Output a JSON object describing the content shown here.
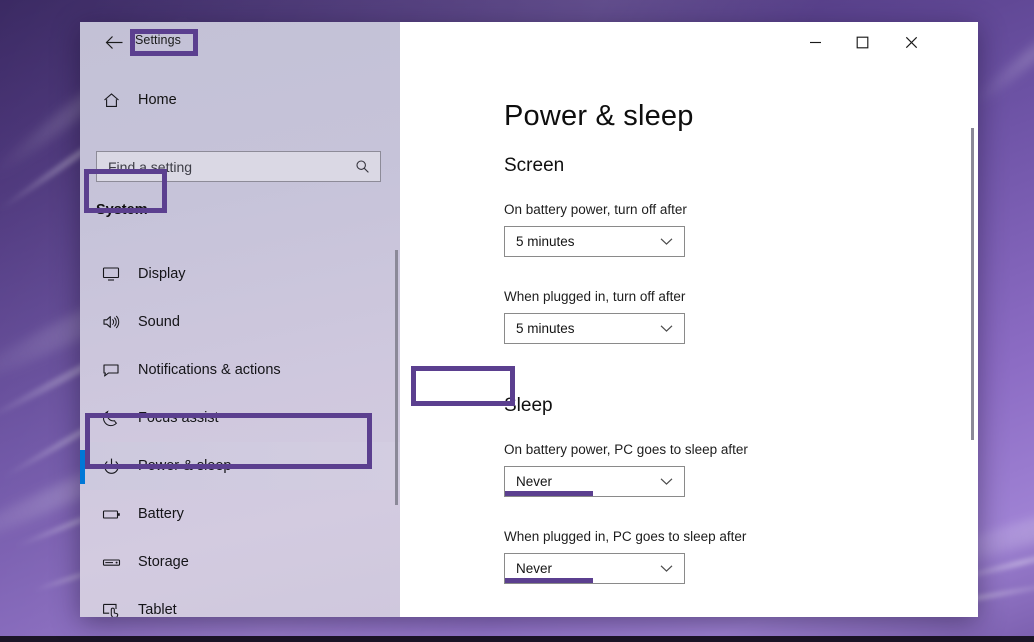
{
  "window": {
    "app_title": "Settings",
    "back_icon": "back-arrow-icon",
    "minimize_label": "─",
    "maximize_label": "□",
    "close_label": "✕"
  },
  "sidebar": {
    "home_label": "Home",
    "home_icon": "home-icon",
    "search": {
      "placeholder": "Find a setting",
      "value": "Find a setting",
      "icon": "search-icon"
    },
    "category_label": "System",
    "items": [
      {
        "label": "Display",
        "icon": "monitor-icon",
        "selected": false
      },
      {
        "label": "Sound",
        "icon": "speaker-icon",
        "selected": false
      },
      {
        "label": "Notifications & actions",
        "icon": "notification-icon",
        "selected": false
      },
      {
        "label": "Focus assist",
        "icon": "moon-icon",
        "selected": false
      },
      {
        "label": "Power & sleep",
        "icon": "power-icon",
        "selected": true
      },
      {
        "label": "Battery",
        "icon": "battery-icon",
        "selected": false
      },
      {
        "label": "Storage",
        "icon": "storage-icon",
        "selected": false
      },
      {
        "label": "Tablet",
        "icon": "tablet-icon",
        "selected": false
      }
    ]
  },
  "main": {
    "page_title": "Power & sleep",
    "sections": [
      {
        "heading": "Screen",
        "fields": [
          {
            "label": "On battery power, turn off after",
            "value": "5 minutes",
            "underlined": false
          },
          {
            "label": "When plugged in, turn off after",
            "value": "5 minutes",
            "underlined": false
          }
        ]
      },
      {
        "heading": "Sleep",
        "fields": [
          {
            "label": "On battery power, PC goes to sleep after",
            "value": "Never",
            "underlined": true
          },
          {
            "label": "When plugged in, PC goes to sleep after",
            "value": "Never",
            "underlined": true
          }
        ]
      }
    ]
  },
  "annotations": {
    "highlight_color": "#5b3f8f",
    "accent_color": "#0078d7",
    "boxes": [
      "Settings",
      "System",
      "Power & sleep",
      "Sleep"
    ]
  }
}
